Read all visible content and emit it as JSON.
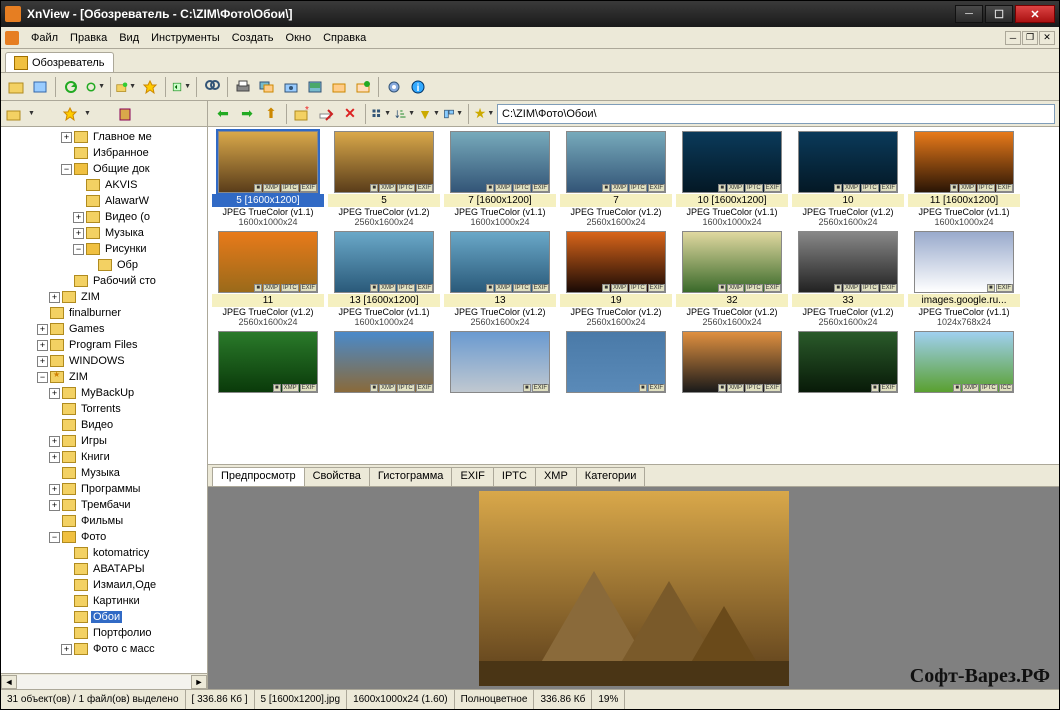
{
  "title": "XnView - [Обозреватель - C:\\ZIM\\Фото\\Обои\\]",
  "menubar": [
    "Файл",
    "Правка",
    "Вид",
    "Инструменты",
    "Создать",
    "Окно",
    "Справка"
  ],
  "tab_browser": "Обозреватель",
  "address": "C:\\ZIM\\Фото\\Обои\\",
  "tree": [
    {
      "d": 5,
      "t": "▸",
      "l": "Главное ме",
      "ic": "folder"
    },
    {
      "d": 5,
      "t": " ",
      "l": "Избранное",
      "ic": "folder"
    },
    {
      "d": 5,
      "t": "▾",
      "l": "Общие док",
      "ic": "open"
    },
    {
      "d": 6,
      "t": " ",
      "l": "AKVIS",
      "ic": "folder"
    },
    {
      "d": 6,
      "t": " ",
      "l": "AlawarW",
      "ic": "folder"
    },
    {
      "d": 6,
      "t": "▸",
      "l": "Видео (о",
      "ic": "folder"
    },
    {
      "d": 6,
      "t": "▸",
      "l": "Музыка",
      "ic": "folder"
    },
    {
      "d": 6,
      "t": "▾",
      "l": "Рисунки",
      "ic": "open"
    },
    {
      "d": 7,
      "t": " ",
      "l": "Обр",
      "ic": "folder"
    },
    {
      "d": 5,
      "t": " ",
      "l": "Рабочий сто",
      "ic": "folder"
    },
    {
      "d": 4,
      "t": "▸",
      "l": "ZIM",
      "ic": "folder"
    },
    {
      "d": 3,
      "t": " ",
      "l": "finalburner",
      "ic": "folder"
    },
    {
      "d": 3,
      "t": "▸",
      "l": "Games",
      "ic": "folder"
    },
    {
      "d": 3,
      "t": "▸",
      "l": "Program Files",
      "ic": "folder"
    },
    {
      "d": 3,
      "t": "▸",
      "l": "WINDOWS",
      "ic": "folder"
    },
    {
      "d": 3,
      "t": "▾",
      "l": "ZIM",
      "ic": "star"
    },
    {
      "d": 4,
      "t": "▸",
      "l": "MyBackUp",
      "ic": "folder"
    },
    {
      "d": 4,
      "t": " ",
      "l": "Torrents",
      "ic": "folder"
    },
    {
      "d": 4,
      "t": " ",
      "l": "Видео",
      "ic": "folder"
    },
    {
      "d": 4,
      "t": "▸",
      "l": "Игры",
      "ic": "folder"
    },
    {
      "d": 4,
      "t": "▸",
      "l": "Книги",
      "ic": "folder"
    },
    {
      "d": 4,
      "t": " ",
      "l": "Музыка",
      "ic": "folder"
    },
    {
      "d": 4,
      "t": "▸",
      "l": "Программы",
      "ic": "folder"
    },
    {
      "d": 4,
      "t": "▸",
      "l": "Трембачи",
      "ic": "folder"
    },
    {
      "d": 4,
      "t": " ",
      "l": "Фильмы",
      "ic": "folder"
    },
    {
      "d": 4,
      "t": "▾",
      "l": "Фото",
      "ic": "open"
    },
    {
      "d": 5,
      "t": " ",
      "l": "kotomatricy",
      "ic": "folder"
    },
    {
      "d": 5,
      "t": " ",
      "l": "АВАТАРЫ",
      "ic": "folder"
    },
    {
      "d": 5,
      "t": " ",
      "l": "Измаил,Оде",
      "ic": "folder"
    },
    {
      "d": 5,
      "t": " ",
      "l": "Картинки",
      "ic": "folder"
    },
    {
      "d": 5,
      "t": " ",
      "l": "Обои",
      "ic": "folder",
      "sel": true
    },
    {
      "d": 5,
      "t": " ",
      "l": "Портфолио",
      "ic": "folder"
    },
    {
      "d": 5,
      "t": "▸",
      "l": "Фото с масс",
      "ic": "folder"
    }
  ],
  "thumbs": [
    {
      "name": "5 [1600x1200]",
      "info": "JPEG TrueColor (v1.1)",
      "dim": "1600x1000x24",
      "sel": true,
      "bg": "linear-gradient(#d9a84a,#5a3d1a)",
      "bd": [
        "XMP",
        "IPTC",
        "EXIF"
      ]
    },
    {
      "name": "5",
      "info": "JPEG TrueColor (v1.2)",
      "dim": "2560x1600x24",
      "bg": "linear-gradient(#d9a84a,#5a3d1a)",
      "bd": [
        "XMP",
        "IPTC",
        "EXIF"
      ]
    },
    {
      "name": "7 [1600x1200]",
      "info": "JPEG TrueColor (v1.1)",
      "dim": "1600x1000x24",
      "bg": "linear-gradient(#7ab,#357)",
      "bd": [
        "XMP",
        "IPTC",
        "EXIF"
      ]
    },
    {
      "name": "7",
      "info": "JPEG TrueColor (v1.2)",
      "dim": "2560x1600x24",
      "bg": "linear-gradient(#7ab,#357)",
      "bd": [
        "XMP",
        "IPTC",
        "EXIF"
      ]
    },
    {
      "name": "10 [1600x1200]",
      "info": "JPEG TrueColor (v1.1)",
      "dim": "1600x1000x24",
      "bg": "linear-gradient(#0a3a5a,#041825)",
      "bd": [
        "XMP",
        "IPTC",
        "EXIF"
      ]
    },
    {
      "name": "10",
      "info": "JPEG TrueColor (v1.2)",
      "dim": "2560x1600x24",
      "bg": "linear-gradient(#0a3a5a,#041825)",
      "bd": [
        "XMP",
        "IPTC",
        "EXIF"
      ]
    },
    {
      "name": "11 [1600x1200]",
      "info": "JPEG TrueColor (v1.1)",
      "dim": "1600x1000x24",
      "bg": "linear-gradient(#e87a1a,#2a1505)",
      "bd": [
        "XMP",
        "IPTC",
        "EXIF"
      ]
    },
    {
      "name": "11",
      "info": "JPEG TrueColor (v1.2)",
      "dim": "2560x1600x24",
      "bg": "linear-gradient(#e87a1a,#9a6a1a)",
      "bd": [
        "XMP",
        "IPTC",
        "EXIF"
      ]
    },
    {
      "name": "13 [1600x1200]",
      "info": "JPEG TrueColor (v1.1)",
      "dim": "1600x1000x24",
      "bg": "linear-gradient(#6aa8c8,#2a5a7a)",
      "bd": [
        "XMP",
        "IPTC",
        "EXIF"
      ]
    },
    {
      "name": "13",
      "info": "JPEG TrueColor (v1.2)",
      "dim": "2560x1600x24",
      "bg": "linear-gradient(#6aa8c8,#2a5a7a)",
      "bd": [
        "XMP",
        "IPTC",
        "EXIF"
      ]
    },
    {
      "name": "19",
      "info": "JPEG TrueColor (v1.2)",
      "dim": "2560x1600x24",
      "bg": "linear-gradient(#d8651a,#1a0a05)",
      "bd": [
        "XMP",
        "IPTC",
        "EXIF"
      ]
    },
    {
      "name": "32",
      "info": "JPEG TrueColor (v1.2)",
      "dim": "2560x1600x24",
      "bg": "linear-gradient(#e0d8a0,#3a6a2a)",
      "bd": [
        "XMP",
        "IPTC",
        "EXIF"
      ]
    },
    {
      "name": "33",
      "info": "JPEG TrueColor (v1.2)",
      "dim": "2560x1600x24",
      "bg": "linear-gradient(#888,#222)",
      "bd": [
        "XMP",
        "IPTC",
        "EXIF"
      ]
    },
    {
      "name": "images.google.ru...",
      "info": "JPEG TrueColor (v1.1)",
      "dim": "1024x768x24",
      "bg": "linear-gradient(#9ac,#fff)",
      "bd": [
        "EXIF"
      ]
    },
    {
      "name": "",
      "info": "",
      "dim": "",
      "bg": "linear-gradient(#2a7a2a,#0a3a0a)",
      "bd": [
        "XMP",
        "EXIF"
      ]
    },
    {
      "name": "",
      "info": "",
      "dim": "",
      "bg": "linear-gradient(#4a8aca,#8a6a3a)",
      "bd": [
        "XMP",
        "IPTC",
        "EXIF"
      ]
    },
    {
      "name": "",
      "info": "",
      "dim": "",
      "bg": "linear-gradient(#6a9ad0,#c0c8d0)",
      "bd": [
        "EXIF"
      ]
    },
    {
      "name": "",
      "info": "",
      "dim": "",
      "bg": "linear-gradient(#4a7aa8,#5a8ab8)",
      "bd": [
        "EXIF"
      ]
    },
    {
      "name": "",
      "info": "",
      "dim": "",
      "bg": "linear-gradient(#e09040,#1a1a1a)",
      "bd": [
        "XMP",
        "IPTC",
        "EXIF"
      ]
    },
    {
      "name": "",
      "info": "",
      "dim": "",
      "bg": "linear-gradient(#2a5a2a,#081a08)",
      "bd": [
        "EXIF"
      ]
    },
    {
      "name": "",
      "info": "",
      "dim": "",
      "bg": "linear-gradient(#a0d0f0,#5aa030)",
      "bd": [
        "XMP",
        "IPTC",
        "ICC"
      ]
    }
  ],
  "preview_tabs": [
    "Предпросмотр",
    "Свойства",
    "Гистограмма",
    "EXIF",
    "IPTC",
    "XMP",
    "Категории"
  ],
  "status": {
    "objects": "31 объект(ов) / 1 файл(ов) выделено",
    "kb": "[ 336.86 Кб ]",
    "file": "5 [1600x1200].jpg",
    "dim": "1600x1000x24 (1.60)",
    "ctype": "Полноцветное",
    "size": "336.86 Кб",
    "zoom": "19%"
  },
  "watermark": "Софт-Варез.РФ"
}
